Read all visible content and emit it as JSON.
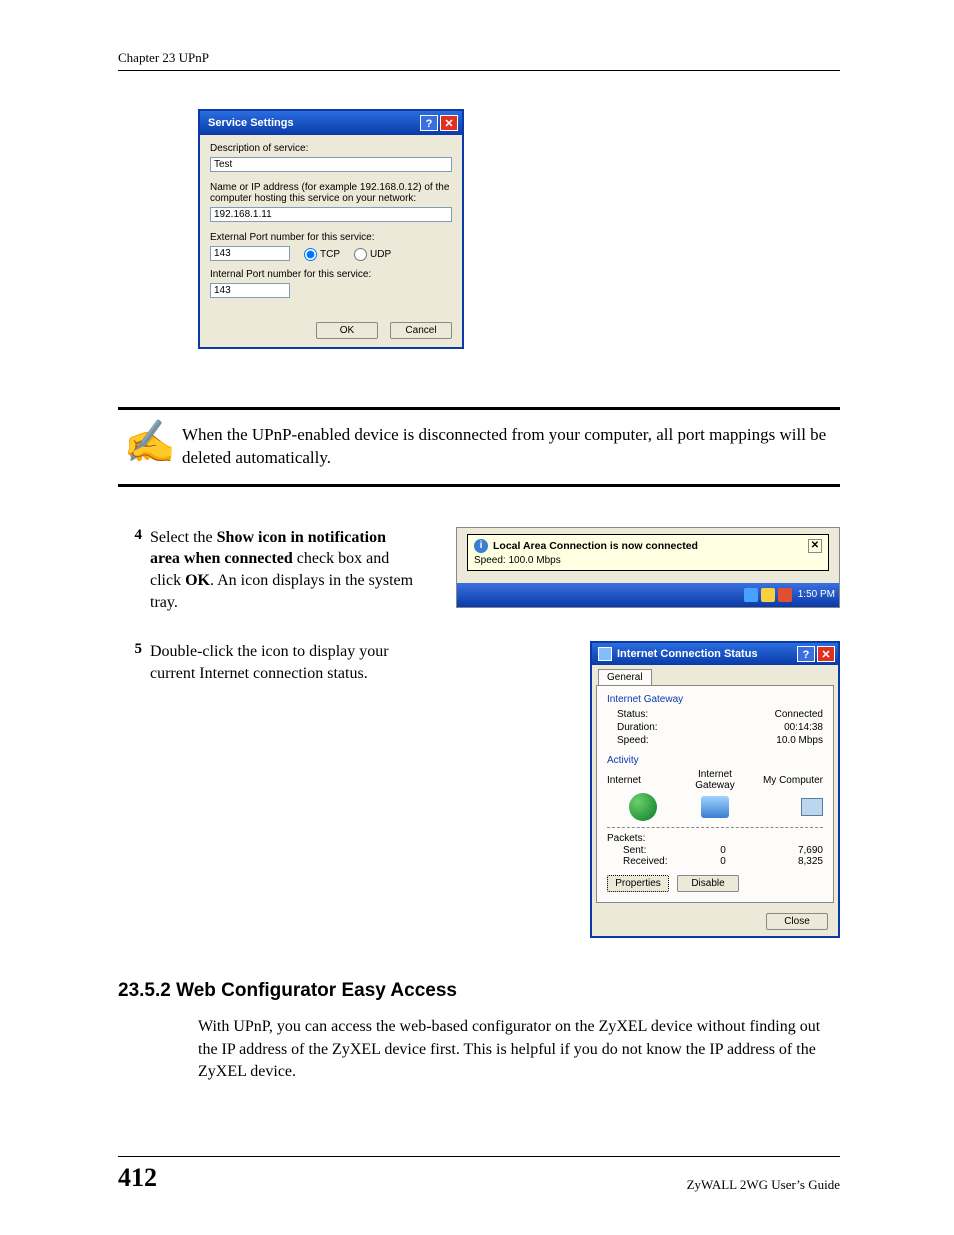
{
  "header": {
    "chapter": "Chapter 23 UPnP"
  },
  "dlg1": {
    "title": "Service Settings",
    "help": "?",
    "close": "✕",
    "label_desc": "Description of service:",
    "value_desc": "Test",
    "label_host": "Name or IP address (for example 192.168.0.12) of the computer hosting this service on your network:",
    "value_host": "192.168.1.11",
    "label_ext": "External Port number for this service:",
    "value_ext": "143",
    "label_tcp": "TCP",
    "label_udp": "UDP",
    "label_int": "Internal Port number for this service:",
    "value_int": "143",
    "ok": "OK",
    "cancel": "Cancel"
  },
  "note": {
    "icon": "✍",
    "text": "When the UPnP-enabled device is disconnected from your computer, all port mappings will be deleted automatically."
  },
  "step4": {
    "num": "4",
    "t1": "Select the ",
    "b1": "Show icon in notification area when connected",
    "t2": " check box and click ",
    "b2": "OK",
    "t3": ". An icon displays in the system tray."
  },
  "step5": {
    "num": "5",
    "text": "Double-click the icon to display your current Internet connection status."
  },
  "tray": {
    "balloon_title": "Local Area Connection is now connected",
    "speed": "Speed: 100.0 Mbps",
    "close": "✕",
    "time": "1:50 PM"
  },
  "dlg2": {
    "title": "Internet Connection Status",
    "help": "?",
    "close": "✕",
    "tab": "General",
    "grp_ig": "Internet Gateway",
    "status_l": "Status:",
    "status_v": "Connected",
    "dur_l": "Duration:",
    "dur_v": "00:14:38",
    "speed_l": "Speed:",
    "speed_v": "10.0 Mbps",
    "grp_act": "Activity",
    "act_internet": "Internet",
    "act_gw": "Internet Gateway",
    "act_pc": "My Computer",
    "pkt_l": "Packets:",
    "sent_l": "Sent:",
    "sent_v1": "0",
    "sent_v2": "7,690",
    "recv_l": "Received:",
    "recv_v1": "0",
    "recv_v2": "8,325",
    "btn_prop": "Properties",
    "btn_dis": "Disable",
    "btn_close": "Close"
  },
  "section": {
    "heading": "23.5.2  Web Configurator Easy Access",
    "para": "With UPnP, you can access the web-based configurator on the ZyXEL device without finding out the IP address of the ZyXEL device first. This is helpful if you do not know the IP address of the ZyXEL device."
  },
  "footer": {
    "page": "412",
    "guide": "ZyWALL 2WG User’s Guide"
  }
}
